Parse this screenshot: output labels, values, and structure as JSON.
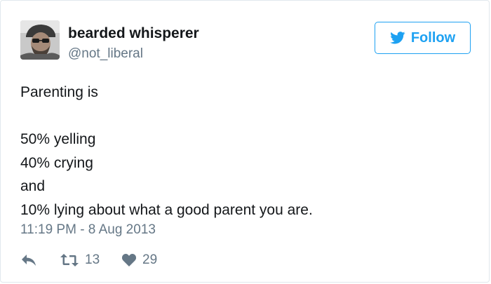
{
  "user": {
    "display_name": "bearded whisperer",
    "handle": "@not_liberal",
    "avatar_icon": "profile-photo"
  },
  "follow_button": {
    "label": "Follow",
    "icon": "twitter-bird-icon",
    "accent_color": "#1da1f2"
  },
  "tweet": {
    "lines": [
      "Parenting is",
      "",
      "50% yelling",
      "40% crying",
      "and",
      "10% lying about what a good parent you are."
    ],
    "timestamp": "11:19 PM - 8 Aug 2013"
  },
  "actions": {
    "reply": {
      "icon": "reply-icon"
    },
    "retweet": {
      "icon": "retweet-icon",
      "count": "13"
    },
    "like": {
      "icon": "heart-icon",
      "count": "29"
    }
  },
  "colors": {
    "text_primary": "#14171a",
    "text_secondary": "#657786",
    "border": "#e1e8ed"
  }
}
